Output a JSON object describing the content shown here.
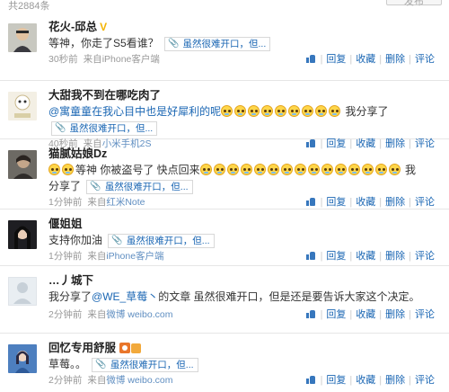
{
  "header": {
    "total": "共2884条",
    "button": "发布"
  },
  "actions": {
    "like": "",
    "reply": "回复",
    "fav": "收藏",
    "delete": "删除",
    "comment": "评论"
  },
  "share_label": "虽然很难开口，但...",
  "comments": [
    {
      "name": "花火-邱总",
      "badge": "V",
      "text": "等神，你走了S5看谁？",
      "time": "30秒前",
      "source_prefix": "来自",
      "source": "iPhone客户端"
    },
    {
      "name": "大甜我不到在哪吃肉了",
      "mention": "@寓童童在我心目中也是好犀利的呢",
      "text_after": "我分享了",
      "time": "40秒前",
      "source_prefix": "来自",
      "source": "小米手机2S"
    },
    {
      "name": "猫腻姑娘Dz",
      "text1": "等神 你被盗号了 快点回来",
      "text2": "我",
      "text3": "分享了",
      "time": "1分钟前",
      "source_prefix": "来自",
      "source": "红米Note"
    },
    {
      "name": "偃姐姐",
      "text": "支持你加油",
      "time": "1分钟前",
      "source_prefix": "来自",
      "source": "iPhone客户端"
    },
    {
      "name": "…丿城下",
      "text_before": "我分享了",
      "mention": "@WE_草莓丶",
      "text_after": "的文章 虽然很难开口，但是还是要告诉大家这个决定。",
      "time": "2分钟前",
      "source_prefix": "来自",
      "source": "微博 weibo.com"
    },
    {
      "name": "回忆专用舒服",
      "text": "草莓。。",
      "time": "2分钟前",
      "source_prefix": "来自",
      "source": "微博 weibo.com"
    }
  ]
}
